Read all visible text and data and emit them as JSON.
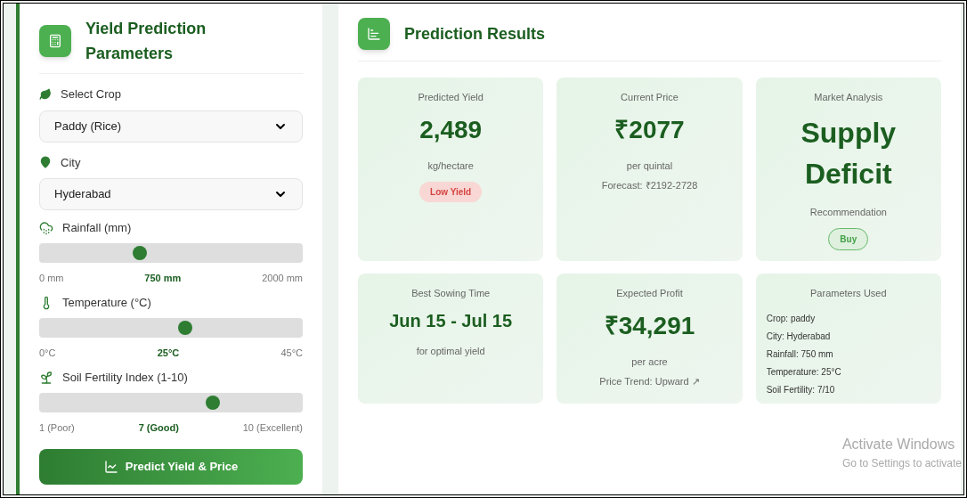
{
  "parameters": {
    "title": "Yield Prediction Parameters",
    "selects": [
      {
        "kind": "crop",
        "label": "Select Crop",
        "value": "Paddy (Rice)"
      },
      {
        "kind": "city",
        "label": "City",
        "value": "Hyderabad"
      }
    ],
    "sliders": [
      {
        "kind": "rain",
        "label": "Rainfall (mm)",
        "level": 0.375,
        "min": "0 mm",
        "reading": "750 mm",
        "max": "2000 mm"
      },
      {
        "kind": "temp",
        "label": "Temperature (°C)",
        "level": 0.556,
        "min": "0°C",
        "reading": "25°C",
        "max": "45°C"
      },
      {
        "kind": "soil",
        "label": "Soil Fertility Index (1-10)",
        "level": 0.667,
        "min": "1 (Poor)",
        "reading": "7 (Good)",
        "max": "10 (Excellent)"
      }
    ],
    "button": "Predict Yield & Price"
  },
  "results": {
    "title": "Prediction Results",
    "cards": [
      {
        "kind": "stat",
        "label": "Predicted Yield",
        "value": "2,489",
        "lines": [
          "kg/hectare"
        ],
        "badge": {
          "text": "Low Yield",
          "kind": "warning"
        }
      },
      {
        "kind": "stat",
        "label": "Current Price",
        "value": "₹2077",
        "lines": [
          "per quintal",
          "Forecast: ₹2192-2728"
        ]
      },
      {
        "kind": "stat",
        "label": "Market Analysis",
        "value": "Supply Deficit",
        "lines": [
          "Recommendation"
        ],
        "badge": {
          "text": "Buy",
          "kind": "success"
        }
      },
      {
        "kind": "stat",
        "label": "Best Sowing Time",
        "value": "Jun 15 - Jul 15",
        "lines": [
          "for optimal yield"
        ]
      },
      {
        "kind": "stat",
        "label": "Expected Profit",
        "value": "₹34,291",
        "lines": [
          "per acre",
          "Price Trend: Upward ↗"
        ]
      },
      {
        "kind": "list",
        "label": "Parameters Used",
        "items": [
          "Crop: paddy",
          "City: Hyderabad",
          "Rainfall: 750 mm",
          "Temperature: 25°C",
          "Soil Fertility: 7/10"
        ]
      }
    ]
  },
  "os_notice": {
    "title": "Activate Windows",
    "subtitle": "Go to Settings to activate"
  }
}
